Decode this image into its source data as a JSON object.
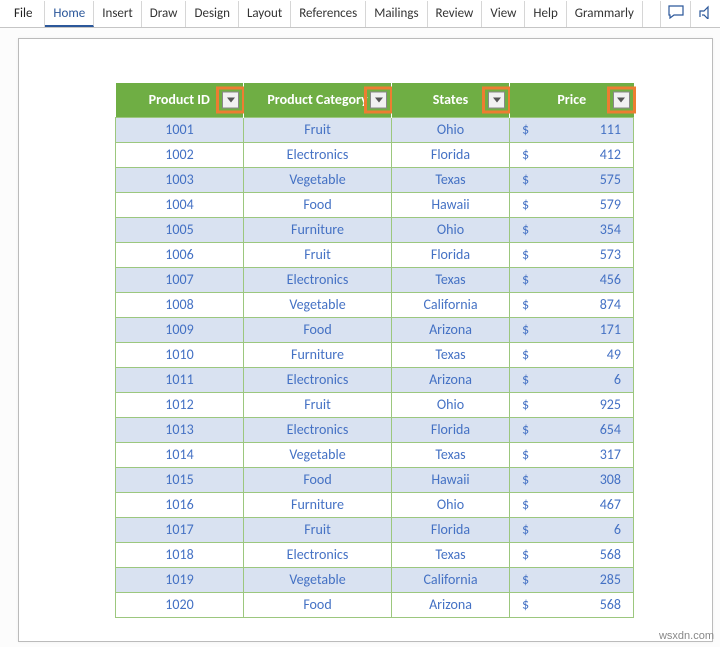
{
  "ribbon": {
    "tabs": [
      "File",
      "Home",
      "Insert",
      "Draw",
      "Design",
      "Layout",
      "References",
      "Mailings",
      "Review",
      "View",
      "Help",
      "Grammarly"
    ],
    "active": "Home"
  },
  "table": {
    "headers": [
      "Product ID",
      "Product Category",
      "States",
      "Price"
    ],
    "currency": "$",
    "rows": [
      {
        "id": "1001",
        "cat": "Fruit",
        "state": "Ohio",
        "price": "111"
      },
      {
        "id": "1002",
        "cat": "Electronics",
        "state": "Florida",
        "price": "412"
      },
      {
        "id": "1003",
        "cat": "Vegetable",
        "state": "Texas",
        "price": "575"
      },
      {
        "id": "1004",
        "cat": "Food",
        "state": "Hawaii",
        "price": "579"
      },
      {
        "id": "1005",
        "cat": "Furniture",
        "state": "Ohio",
        "price": "354"
      },
      {
        "id": "1006",
        "cat": "Fruit",
        "state": "Florida",
        "price": "573"
      },
      {
        "id": "1007",
        "cat": "Electronics",
        "state": "Texas",
        "price": "456"
      },
      {
        "id": "1008",
        "cat": "Vegetable",
        "state": "California",
        "price": "874"
      },
      {
        "id": "1009",
        "cat": "Food",
        "state": "Arizona",
        "price": "171"
      },
      {
        "id": "1010",
        "cat": "Furniture",
        "state": "Texas",
        "price": "49"
      },
      {
        "id": "1011",
        "cat": "Electronics",
        "state": "Arizona",
        "price": "6"
      },
      {
        "id": "1012",
        "cat": "Fruit",
        "state": "Ohio",
        "price": "925"
      },
      {
        "id": "1013",
        "cat": "Electronics",
        "state": "Florida",
        "price": "654"
      },
      {
        "id": "1014",
        "cat": "Vegetable",
        "state": "Texas",
        "price": "317"
      },
      {
        "id": "1015",
        "cat": "Food",
        "state": "Hawaii",
        "price": "308"
      },
      {
        "id": "1016",
        "cat": "Furniture",
        "state": "Ohio",
        "price": "467"
      },
      {
        "id": "1017",
        "cat": "Fruit",
        "state": "Florida",
        "price": "6"
      },
      {
        "id": "1018",
        "cat": "Electronics",
        "state": "Texas",
        "price": "568"
      },
      {
        "id": "1019",
        "cat": "Vegetable",
        "state": "California",
        "price": "285"
      },
      {
        "id": "1020",
        "cat": "Food",
        "state": "Arizona",
        "price": "568"
      }
    ]
  },
  "watermark": "wsxdn.com"
}
